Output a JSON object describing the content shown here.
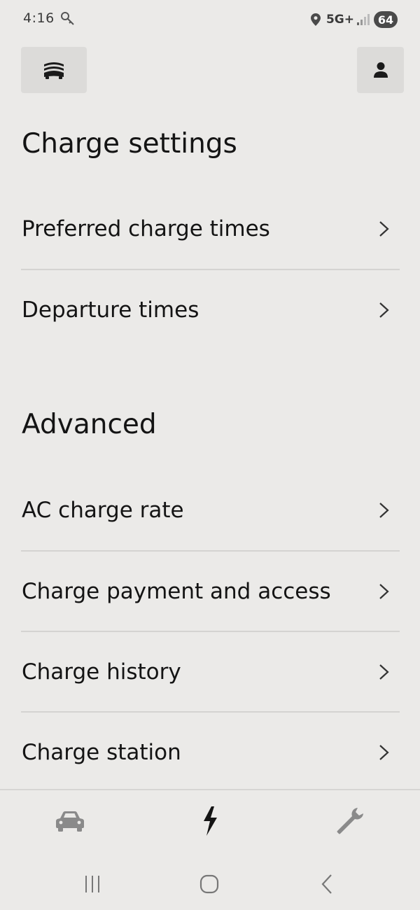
{
  "status_bar": {
    "time": "4:16",
    "network": "5G+",
    "battery": "64",
    "icons": [
      "key-icon",
      "location-icon",
      "signal-icon",
      "battery-icon"
    ]
  },
  "header": {
    "menu_icon": "stack-icon",
    "profile_icon": "person-icon"
  },
  "sections": [
    {
      "title": "Charge settings",
      "items": [
        {
          "label": "Preferred charge times"
        },
        {
          "label": "Departure times"
        }
      ]
    },
    {
      "title": "Advanced",
      "items": [
        {
          "label": "AC charge rate"
        },
        {
          "label": "Charge payment and access"
        },
        {
          "label": "Charge history"
        },
        {
          "label": "Charge station"
        }
      ]
    }
  ],
  "bottom_nav": {
    "items": [
      {
        "icon": "car-icon",
        "active": false
      },
      {
        "icon": "lightning-icon",
        "active": true
      },
      {
        "icon": "wrench-icon",
        "active": false
      }
    ]
  },
  "system_nav": {
    "buttons": [
      "recents",
      "home",
      "back"
    ]
  },
  "colors": {
    "background": "#ebeae8",
    "text": "#141414",
    "button_bg": "#dcdbd9",
    "divider": "#d4d3d1",
    "inactive_icon": "#8a8a8a"
  }
}
